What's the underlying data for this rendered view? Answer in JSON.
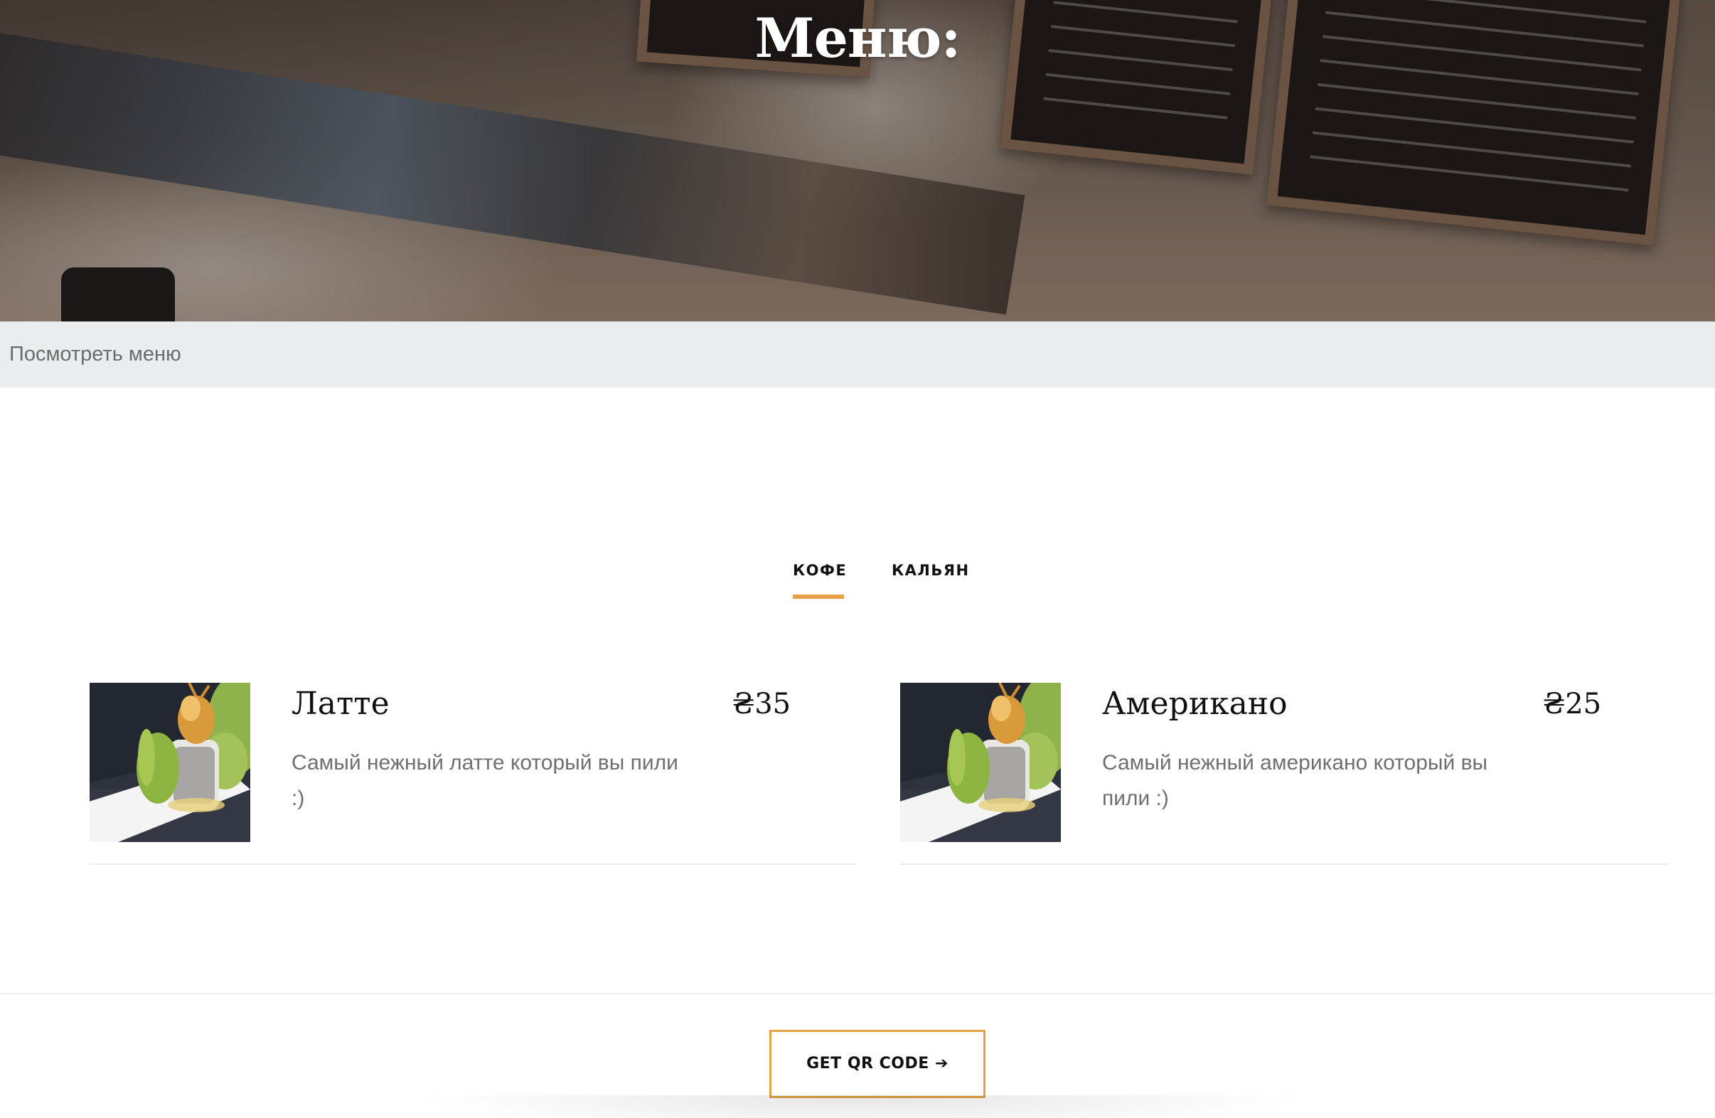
{
  "hero": {
    "title": "Меню:"
  },
  "breadcrumb": {
    "label": "Посмотреть меню"
  },
  "tabs": [
    {
      "label": "КОФЕ",
      "active": true
    },
    {
      "label": "КАЛЬЯН",
      "active": false
    }
  ],
  "accent_color": "#e5a143",
  "items": [
    {
      "name": "Латте",
      "price": "₴35",
      "description": "Самый нежный латте который вы пили :)",
      "image_icon": "sushi-roll-photo"
    },
    {
      "name": "Американо",
      "price": "₴25",
      "description": "Самый нежный американо который вы пили :)",
      "image_icon": "sushi-roll-photo"
    }
  ],
  "footer": {
    "qr_button_label": "GET QR CODE ➔"
  }
}
